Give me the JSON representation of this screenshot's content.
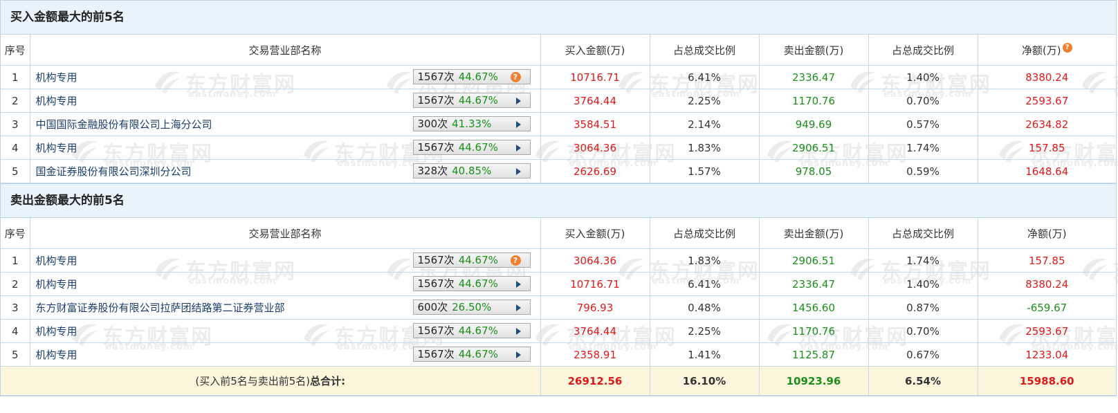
{
  "watermark": {
    "cn": "东方财富网",
    "en": "eastmoney.com"
  },
  "columns": {
    "seq": "序号",
    "name": "交易营业部名称",
    "buy": "买入金额(万)",
    "buy_ratio": "占总成交比例",
    "sell": "卖出金额(万)",
    "sell_ratio": "占总成交比例",
    "net": "净额(万)"
  },
  "buy_section": {
    "title": "买入金额最大的前5名",
    "rows": [
      {
        "seq": "1",
        "name": "机构专用",
        "count": "1567次",
        "pct": "44.67%",
        "tag_icon": "question-icon",
        "buy": "10716.71",
        "buy_ratio": "6.41%",
        "sell": "2336.47",
        "sell_ratio": "1.40%",
        "net": "8380.24",
        "net_color": "red"
      },
      {
        "seq": "2",
        "name": "机构专用",
        "count": "1567次",
        "pct": "44.67%",
        "tag_icon": "play-arrow-icon",
        "buy": "3764.44",
        "buy_ratio": "2.25%",
        "sell": "1170.76",
        "sell_ratio": "0.70%",
        "net": "2593.67",
        "net_color": "red"
      },
      {
        "seq": "3",
        "name": "中国国际金融股份有限公司上海分公司",
        "count": "300次",
        "pct": "41.33%",
        "tag_icon": "play-arrow-icon",
        "buy": "3584.51",
        "buy_ratio": "2.14%",
        "sell": "949.69",
        "sell_ratio": "0.57%",
        "net": "2634.82",
        "net_color": "red"
      },
      {
        "seq": "4",
        "name": "机构专用",
        "count": "1567次",
        "pct": "44.67%",
        "tag_icon": "play-arrow-icon",
        "buy": "3064.36",
        "buy_ratio": "1.83%",
        "sell": "2906.51",
        "sell_ratio": "1.74%",
        "net": "157.85",
        "net_color": "red"
      },
      {
        "seq": "5",
        "name": "国金证券股份有限公司深圳分公司",
        "count": "328次",
        "pct": "40.85%",
        "tag_icon": "play-arrow-icon",
        "buy": "2626.69",
        "buy_ratio": "1.57%",
        "sell": "978.05",
        "sell_ratio": "0.59%",
        "net": "1648.64",
        "net_color": "red"
      }
    ]
  },
  "sell_section": {
    "title": "卖出金额最大的前5名",
    "rows": [
      {
        "seq": "1",
        "name": "机构专用",
        "count": "1567次",
        "pct": "44.67%",
        "tag_icon": "question-icon",
        "buy": "3064.36",
        "buy_ratio": "1.83%",
        "sell": "2906.51",
        "sell_ratio": "1.74%",
        "net": "157.85",
        "net_color": "red"
      },
      {
        "seq": "2",
        "name": "机构专用",
        "count": "1567次",
        "pct": "44.67%",
        "tag_icon": "play-arrow-icon",
        "buy": "10716.71",
        "buy_ratio": "6.41%",
        "sell": "2336.47",
        "sell_ratio": "1.40%",
        "net": "8380.24",
        "net_color": "red"
      },
      {
        "seq": "3",
        "name": "东方财富证券股份有限公司拉萨团结路第二证券营业部",
        "count": "600次",
        "pct": "26.50%",
        "tag_icon": "play-arrow-icon",
        "buy": "796.93",
        "buy_ratio": "0.48%",
        "sell": "1456.60",
        "sell_ratio": "0.87%",
        "net": "-659.67",
        "net_color": "green"
      },
      {
        "seq": "4",
        "name": "机构专用",
        "count": "1567次",
        "pct": "44.67%",
        "tag_icon": "play-arrow-icon",
        "buy": "3764.44",
        "buy_ratio": "2.25%",
        "sell": "1170.76",
        "sell_ratio": "0.70%",
        "net": "2593.67",
        "net_color": "red"
      },
      {
        "seq": "5",
        "name": "机构专用",
        "count": "1567次",
        "pct": "44.67%",
        "tag_icon": "play-arrow-icon",
        "buy": "2358.91",
        "buy_ratio": "1.41%",
        "sell": "1125.87",
        "sell_ratio": "0.67%",
        "net": "1233.04",
        "net_color": "red"
      }
    ]
  },
  "total": {
    "label_prefix": "(买入前5名与卖出前5名)",
    "label_bold": "总合计:",
    "buy": "26912.56",
    "buy_ratio": "16.10%",
    "sell": "10923.96",
    "sell_ratio": "6.54%",
    "net": "15988.60"
  },
  "colors": {
    "up_red": "#e0191b",
    "down_green": "#1a8f1a",
    "title_bg": "#e9f3fb",
    "total_bg": "#fcf6dc",
    "question_orange": "#f08030"
  }
}
